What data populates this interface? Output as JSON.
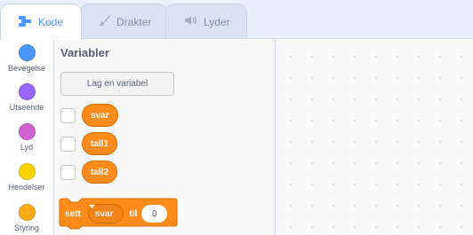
{
  "tabs": [
    {
      "label": "Kode",
      "icon": "code-icon",
      "active": true
    },
    {
      "label": "Drakter",
      "icon": "brush-icon",
      "active": false
    },
    {
      "label": "Lyder",
      "icon": "sound-icon",
      "active": false
    }
  ],
  "categories": [
    {
      "label": "Bevegelse",
      "color": "#4c97ff"
    },
    {
      "label": "Utseende",
      "color": "#9966ff"
    },
    {
      "label": "Lyd",
      "color": "#cf63cf"
    },
    {
      "label": "Hendelser",
      "color": "#ffd500"
    },
    {
      "label": "Styring",
      "color": "#ffab19"
    }
  ],
  "palette": {
    "title": "Variabler",
    "make_variable_button": "Lag en variabel",
    "variables": [
      "svar",
      "tall1",
      "tall2"
    ],
    "set_block": {
      "word_set": "sett",
      "selected_variable": "svar",
      "word_to": "til",
      "value": "0"
    }
  },
  "colors": {
    "accent": "#4c97ff",
    "variables": "#ff8c1a"
  }
}
